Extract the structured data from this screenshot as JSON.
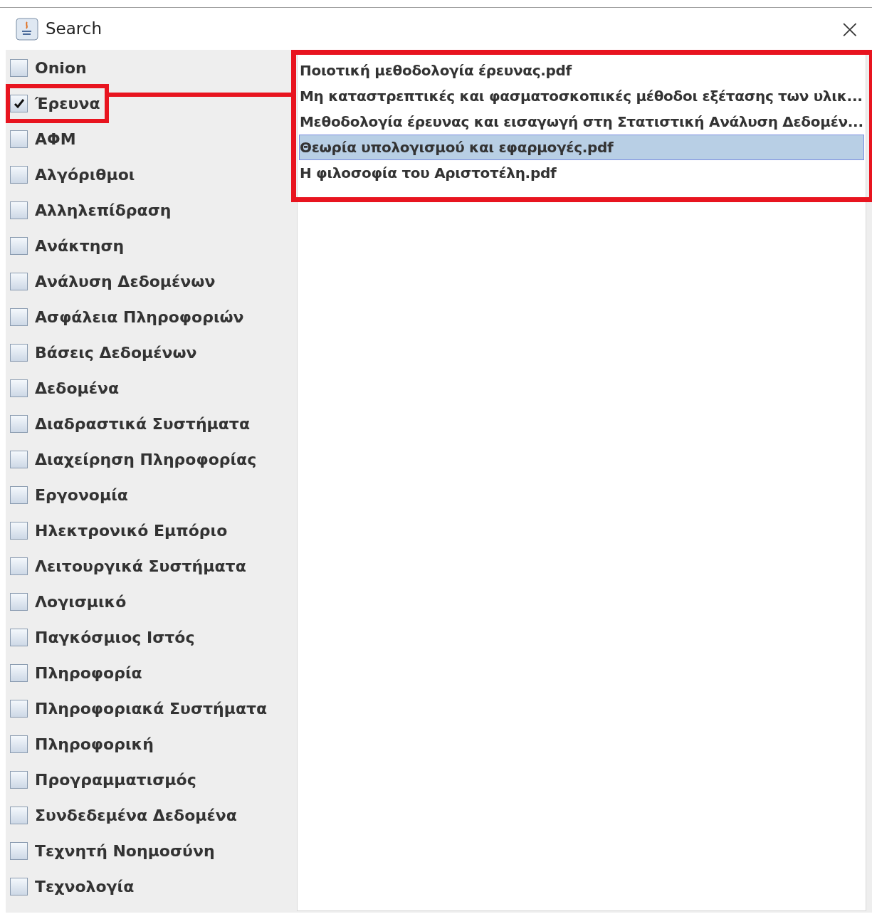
{
  "window": {
    "title": "Search",
    "close": "×"
  },
  "categories": [
    {
      "label": "Onion",
      "checked": false
    },
    {
      "label": "Έρευνα",
      "checked": true
    },
    {
      "label": "ΑΦΜ",
      "checked": false
    },
    {
      "label": "Αλγόριθμοι",
      "checked": false
    },
    {
      "label": "Αλληλεπίδραση",
      "checked": false
    },
    {
      "label": "Ανάκτηση",
      "checked": false
    },
    {
      "label": "Ανάλυση Δεδομένων",
      "checked": false
    },
    {
      "label": "Ασφάλεια Πληροφοριών",
      "checked": false
    },
    {
      "label": "Βάσεις Δεδομένων",
      "checked": false
    },
    {
      "label": "Δεδομένα",
      "checked": false
    },
    {
      "label": "Διαδραστικά Συστήματα",
      "checked": false
    },
    {
      "label": "Διαχείρηση Πληροφορίας",
      "checked": false
    },
    {
      "label": "Εργονομία",
      "checked": false
    },
    {
      "label": "Ηλεκτρονικό Εμπόριο",
      "checked": false
    },
    {
      "label": "Λειτουργικά Συστήματα",
      "checked": false
    },
    {
      "label": "Λογισμικό",
      "checked": false
    },
    {
      "label": "Παγκόσμιος Ιστός",
      "checked": false
    },
    {
      "label": "Πληροφορία",
      "checked": false
    },
    {
      "label": "Πληροφοριακά Συστήματα",
      "checked": false
    },
    {
      "label": "Πληροφορική",
      "checked": false
    },
    {
      "label": "Προγραμματισμός",
      "checked": false
    },
    {
      "label": "Συνδεδεμένα Δεδομένα",
      "checked": false
    },
    {
      "label": "Τεχνητή Νοημοσύνη",
      "checked": false
    },
    {
      "label": "Τεχνολογία",
      "checked": false
    }
  ],
  "results": [
    {
      "label": "Ποιοτική μεθοδολογία έρευνας.pdf",
      "selected": false
    },
    {
      "label": "Μη καταστρεπτικές και φασματοσκοπικές μέθοδοι εξέτασης των υλικ...",
      "selected": false
    },
    {
      "label": "Μεθοδολογία έρευνας και εισαγωγή στη Στατιστική Ανάλυση Δεδομέν...",
      "selected": false
    },
    {
      "label": "Θεωρία υπολογισμού και εφαρμογές.pdf",
      "selected": true
    },
    {
      "label": "Η φιλοσοφία του Αριστοτέλη.pdf",
      "selected": false
    }
  ]
}
